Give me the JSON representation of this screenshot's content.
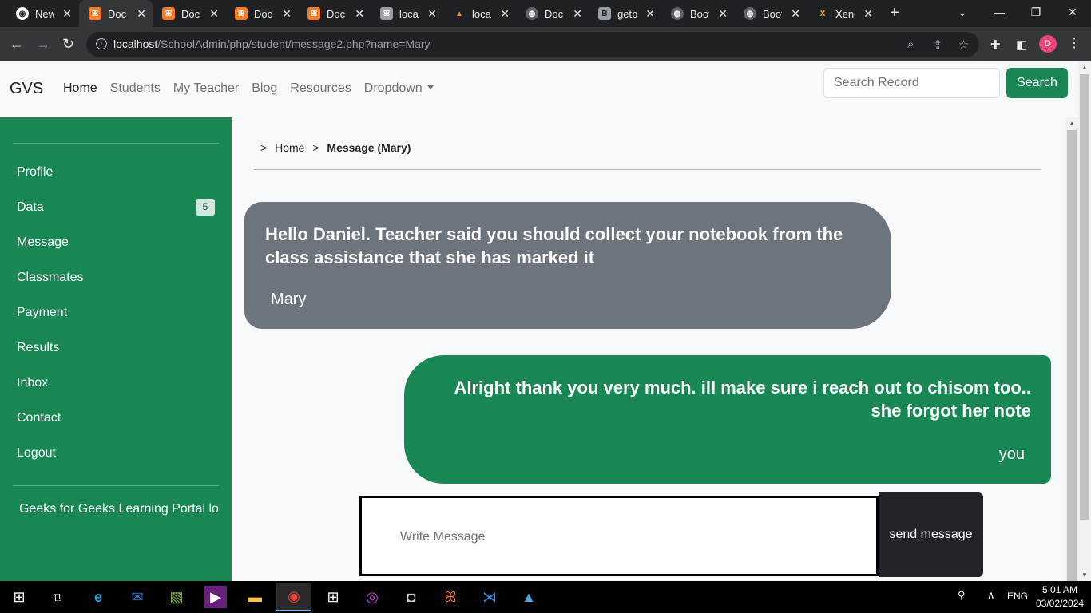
{
  "browser": {
    "tabs": [
      {
        "title": "New",
        "active": false
      },
      {
        "title": "Docu",
        "active": true
      },
      {
        "title": "Docu",
        "active": false
      },
      {
        "title": "Docu",
        "active": false
      },
      {
        "title": "Docu",
        "active": false
      },
      {
        "title": "local",
        "active": false
      },
      {
        "title": "local",
        "active": false
      },
      {
        "title": "Docu",
        "active": false
      },
      {
        "title": "getb",
        "active": false
      },
      {
        "title": "Boot",
        "active": false
      },
      {
        "title": "Boot",
        "active": false
      },
      {
        "title": "Xeno",
        "active": false
      }
    ],
    "url_host": "localhost",
    "url_path": "/SchoolAdmin/php/student/message2.php?name=Mary",
    "profile_initial": "D"
  },
  "navbar": {
    "brand": "GVS",
    "links": [
      "Home",
      "Students",
      "My Teacher",
      "Blog",
      "Resources",
      "Dropdown"
    ],
    "search_placeholder": "Search Record",
    "search_button": "Search"
  },
  "sidebar": {
    "items": [
      "Profile",
      "Data",
      "Message",
      "Classmates",
      "Payment",
      "Results",
      "Inbox",
      "Contact",
      "Logout"
    ],
    "data_badge": "5",
    "footer": "Geeks for Geeks Learning Portal lo"
  },
  "breadcrumb": {
    "sep": ">",
    "home": "Home",
    "current": "Message (Mary)"
  },
  "messages": {
    "incoming": {
      "text": "Hello Daniel. Teacher said you should collect your notebook from the class assistance that she has marked it",
      "sender": "Mary"
    },
    "outgoing": {
      "text": "Alright thank you very much. ill make sure i reach out to chisom too.. she forgot her note",
      "sender": "you"
    }
  },
  "composer": {
    "placeholder": "Write Message",
    "send_label": "send message"
  },
  "taskbar": {
    "lang": "ENG",
    "time": "5:01 AM",
    "date": "03/02/2024"
  },
  "colors": {
    "primary_green": "#198754",
    "incoming_bubble": "#6c757d",
    "dark": "#212529"
  }
}
